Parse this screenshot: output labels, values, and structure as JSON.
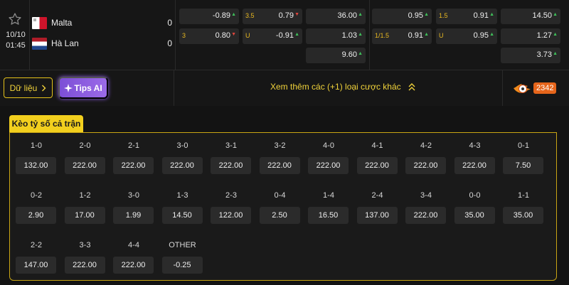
{
  "match": {
    "date": "10/10",
    "time": "01:45",
    "home": {
      "name": "Malta",
      "score": "0"
    },
    "away": {
      "name": "Hà Lan",
      "score": "0"
    }
  },
  "odds": [
    {
      "label": "",
      "value": "-0.89",
      "trend": "up"
    },
    {
      "label": "3.5",
      "value": "0.79",
      "trend": "down"
    },
    {
      "label": "",
      "value": "36.00",
      "trend": "up"
    },
    {
      "label": "",
      "value": "0.95",
      "trend": "up"
    },
    {
      "label": "1.5",
      "value": "0.91",
      "trend": "up"
    },
    {
      "label": "",
      "value": "14.50",
      "trend": "up"
    },
    {
      "label": "3",
      "value": "0.80",
      "trend": "down"
    },
    {
      "label": "U",
      "value": "-0.91",
      "trend": "up"
    },
    {
      "label": "",
      "value": "1.03",
      "trend": "up"
    },
    {
      "label": "1/1.5",
      "value": "0.91",
      "trend": "up"
    },
    {
      "label": "U",
      "value": "0.95",
      "trend": "up"
    },
    {
      "label": "",
      "value": "1.27",
      "trend": "up"
    },
    {
      "label": "",
      "value": "9.60",
      "trend": "up"
    },
    {
      "label": "",
      "value": "3.73",
      "trend": "up"
    }
  ],
  "actions": {
    "data_label": "Dữ liệu",
    "tips_label": "Tips AI",
    "more_label": "Xem thêm các (+1) loại cược khác",
    "hot_count": "2342"
  },
  "correct_score": {
    "tab_label": "Kèo tỷ số cả trận",
    "items": [
      {
        "score": "1-0",
        "odd": "132.00"
      },
      {
        "score": "2-0",
        "odd": "222.00"
      },
      {
        "score": "2-1",
        "odd": "222.00"
      },
      {
        "score": "3-0",
        "odd": "222.00"
      },
      {
        "score": "3-1",
        "odd": "222.00"
      },
      {
        "score": "3-2",
        "odd": "222.00"
      },
      {
        "score": "4-0",
        "odd": "222.00"
      },
      {
        "score": "4-1",
        "odd": "222.00"
      },
      {
        "score": "4-2",
        "odd": "222.00"
      },
      {
        "score": "4-3",
        "odd": "222.00"
      },
      {
        "score": "0-1",
        "odd": "7.50"
      },
      {
        "score": "0-2",
        "odd": "2.90"
      },
      {
        "score": "1-2",
        "odd": "17.00"
      },
      {
        "score": "3-0",
        "odd": "1.99"
      },
      {
        "score": "1-3",
        "odd": "14.50"
      },
      {
        "score": "2-3",
        "odd": "122.00"
      },
      {
        "score": "0-4",
        "odd": "2.50"
      },
      {
        "score": "1-4",
        "odd": "16.50"
      },
      {
        "score": "2-4",
        "odd": "137.00"
      },
      {
        "score": "3-4",
        "odd": "222.00"
      },
      {
        "score": "0-0",
        "odd": "35.00"
      },
      {
        "score": "1-1",
        "odd": "35.00"
      },
      {
        "score": "2-2",
        "odd": "147.00"
      },
      {
        "score": "3-3",
        "odd": "222.00"
      },
      {
        "score": "4-4",
        "odd": "222.00"
      },
      {
        "score": "OTHER",
        "odd": "-0.25"
      }
    ]
  },
  "colors": {
    "accent": "#f2cf1e",
    "tips": "#8a5ae0",
    "hot": "#e6651b",
    "up": "#3fbf5a",
    "down": "#e0463d"
  }
}
